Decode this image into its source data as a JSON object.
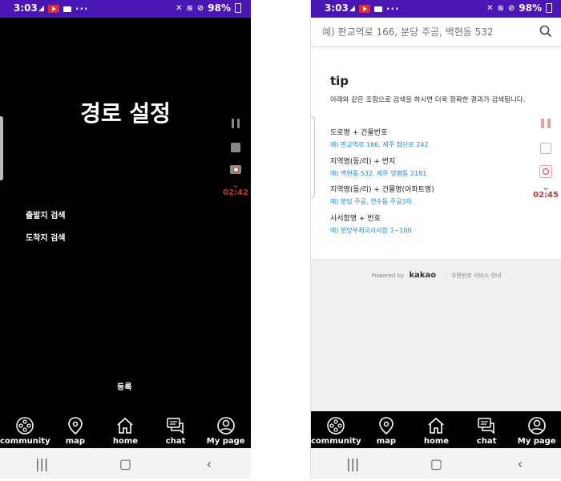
{
  "left": {
    "status": {
      "time": "3:03",
      "battery": "98%"
    },
    "title": "경로 설정",
    "menu": {
      "origin": "출발지 검색",
      "destination": "도착지 검색"
    },
    "register": "등록",
    "timer": "02:42"
  },
  "right": {
    "status": {
      "time": "3:03",
      "battery": "98%"
    },
    "search": {
      "placeholder": "예) 판교역로 166, 분당 주공, 백현동 532"
    },
    "tip": {
      "title": "tip",
      "desc": "아래와 같은 조합으로 검색을 하시면 더욱 정확한 결과가 검색됩니다.",
      "items": [
        {
          "label": "도로명 + 건물번호",
          "example": "예) 판교역로 166,  제주 첨단로 242"
        },
        {
          "label": "지역명(동/리) + 번지",
          "example": "예) 백현동 532,  제주 영평동 2181"
        },
        {
          "label": "지역명(동/리) + 건물명(아파트명)",
          "example": "예) 분당 주공,  연수동 주공3차"
        },
        {
          "label": "사서함명 + 번호",
          "example": "예) 분당우체국사서함 1~100"
        }
      ]
    },
    "footer": {
      "powered": "Powered by",
      "brand": "kakao",
      "service": "우편번호 서비스 안내"
    },
    "timer": "02:45"
  },
  "nav": [
    {
      "label": "community",
      "icon": "community-icon"
    },
    {
      "label": "map",
      "icon": "map-pin-icon"
    },
    {
      "label": "home",
      "icon": "home-icon"
    },
    {
      "label": "chat",
      "icon": "chat-icon"
    },
    {
      "label": "My page",
      "icon": "user-icon"
    }
  ]
}
